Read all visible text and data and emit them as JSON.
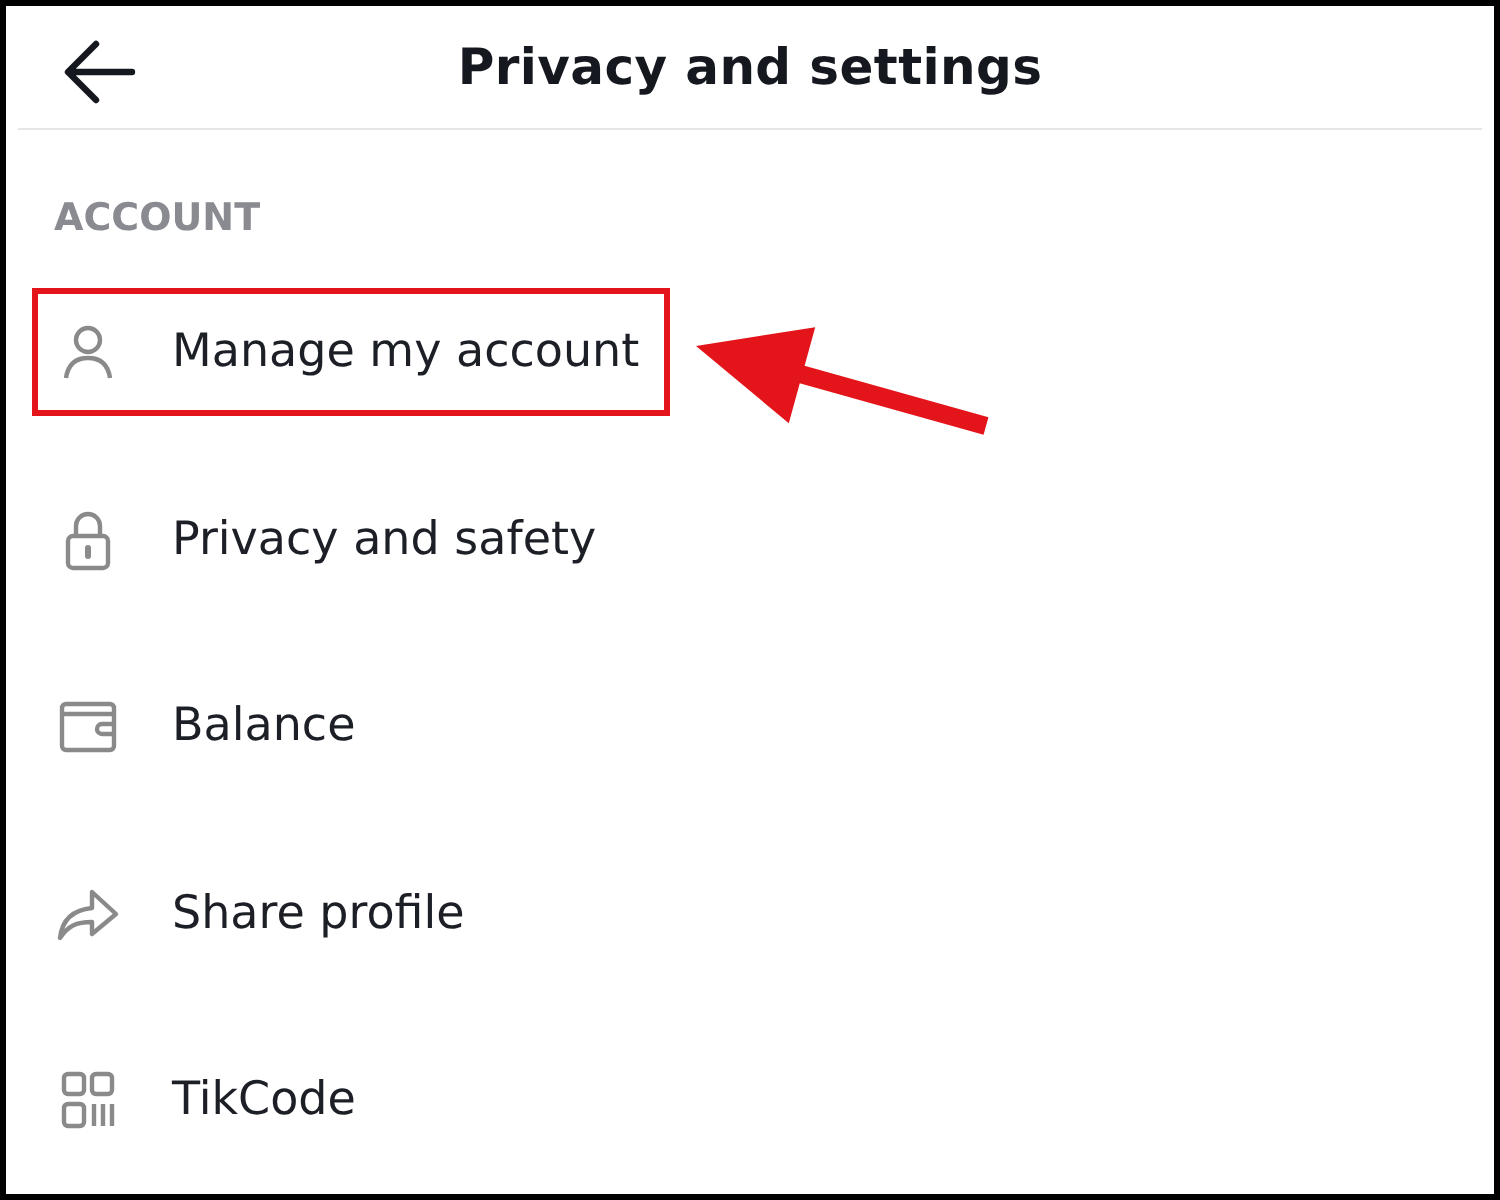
{
  "header": {
    "title": "Privacy and settings"
  },
  "section": {
    "label": "ACCOUNT"
  },
  "items": [
    {
      "label": "Manage my account",
      "kind": "person",
      "highlighted": true
    },
    {
      "label": "Privacy and safety",
      "kind": "lock",
      "highlighted": false
    },
    {
      "label": "Balance",
      "kind": "wallet",
      "highlighted": false
    },
    {
      "label": "Share profile",
      "kind": "share",
      "highlighted": false
    },
    {
      "label": "TikCode",
      "kind": "code",
      "highlighted": false
    }
  ]
}
